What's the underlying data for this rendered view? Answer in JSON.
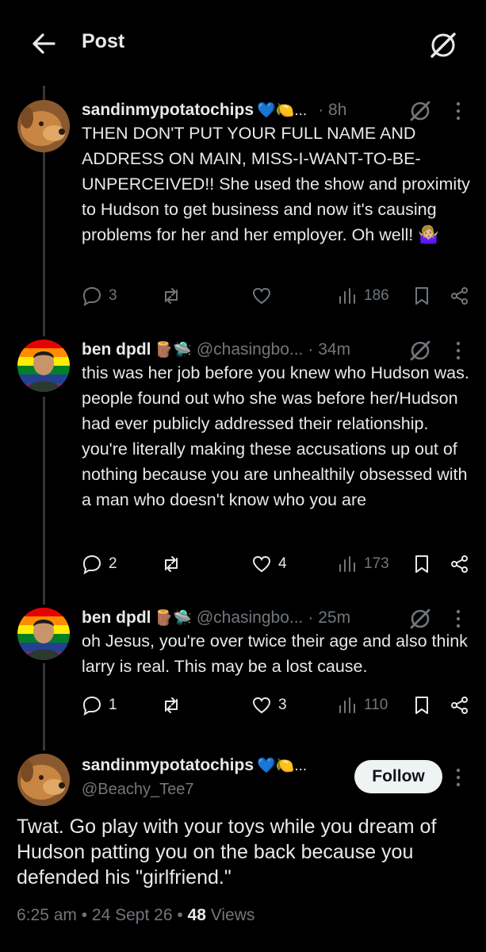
{
  "header": {
    "title": "Post"
  },
  "replies": [
    {
      "name": "sandinmypotatochips",
      "name_emojis": "💙🍋...",
      "handle": "",
      "time": "· 8h",
      "text": "THEN DON'T PUT YOUR FULL NAME AND ADDRESS ON MAIN, MISS-I-WANT-TO-BE-UNPERCEIVED!! She used the show and proximity to Hudson to get business and now it's causing problems for her and her employer.  Oh well! 🤷🏼‍♀️",
      "replies_count": "3",
      "reposts_count": "",
      "likes_count": "",
      "views_count": "186"
    },
    {
      "name": "ben dpdl",
      "name_emojis": "🪵🛸",
      "handle": "@chasingbo...",
      "time": "· 34m",
      "text": "this was her job before you knew who Hudson was. people found out who she was before her/Hudson had ever publicly addressed their relationship. you're literally making these accusations up out of nothing because you are unhealthily obsessed with a man who doesn't know who you are",
      "replies_count": "2",
      "reposts_count": "",
      "likes_count": "4",
      "views_count": "173"
    },
    {
      "name": "ben dpdl",
      "name_emojis": "🪵🛸",
      "handle": "@chasingbo...",
      "time": "· 25m",
      "text": "oh Jesus, you're over twice their age and also think larry is real. This may be a lost cause.",
      "replies_count": "1",
      "reposts_count": "",
      "likes_count": "3",
      "views_count": "110"
    }
  ],
  "main_post": {
    "name": "sandinmypotatochips",
    "name_emojis": "💙🍋...",
    "handle": "@Beachy_Tee7",
    "follow_label": "Follow",
    "text": "Twat. Go play with your toys while you dream of Hudson patting you on the back because you defended his \"girlfriend.\"",
    "time": "6:25 am",
    "date": "24 Sept 26",
    "views": "48",
    "views_label": "Views"
  },
  "colors": {
    "background": "#000000",
    "text_primary": "#e7e9ea",
    "text_secondary": "#71767b",
    "thread_line": "#333639",
    "follow_bg": "#eff3f4"
  }
}
